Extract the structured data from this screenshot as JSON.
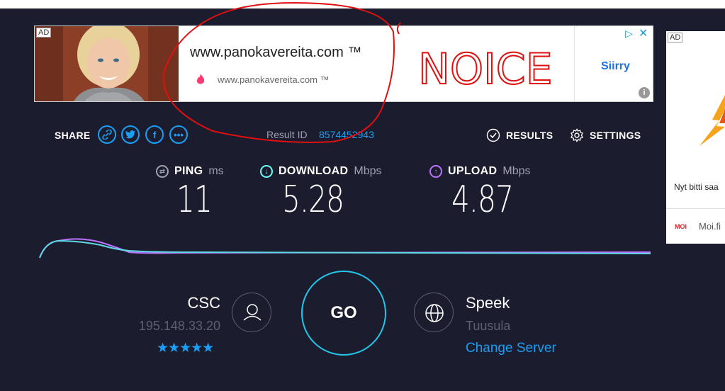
{
  "ad_banner": {
    "badge": "AD",
    "url_main": "www.panokavereita.com ™",
    "url_sub": "www.panokavereita.com ™",
    "cta": "Siirry",
    "adchoices_icon": "adchoices-icon",
    "close_icon": "close-icon",
    "info_icon": "info-icon",
    "info_glyph": "i"
  },
  "annotation": {
    "text": "NOICE",
    "color": "#e01010"
  },
  "side_ad": {
    "badge": "AD",
    "text": "Nyt bitti saa",
    "logo": "MOI",
    "brand": "Moi.fi"
  },
  "share": {
    "label": "SHARE",
    "icons": [
      "link-icon",
      "twitter-icon",
      "facebook-icon",
      "more-icon"
    ]
  },
  "result": {
    "label": "Result ID",
    "id": "8574452943"
  },
  "toolbar": {
    "results_label": "RESULTS",
    "settings_label": "SETTINGS"
  },
  "metrics": {
    "ping": {
      "name": "PING",
      "unit": "ms",
      "value": "11",
      "color": "#9ea0b4"
    },
    "download": {
      "name": "DOWNLOAD",
      "unit": "Mbps",
      "value": "5.28",
      "color": "#6afff3"
    },
    "upload": {
      "name": "UPLOAD",
      "unit": "Mbps",
      "value": "4.87",
      "color": "#bf71ff"
    }
  },
  "provider": {
    "isp": "CSC",
    "ip": "195.148.33.20",
    "stars": "★★★★★"
  },
  "go_label": "GO",
  "server": {
    "name": "Speek",
    "location": "Tuusula",
    "change_label": "Change Server"
  },
  "colors": {
    "background": "#1b1c2e",
    "accent": "#1c9ef2",
    "go_ring": "#22c6e8"
  }
}
